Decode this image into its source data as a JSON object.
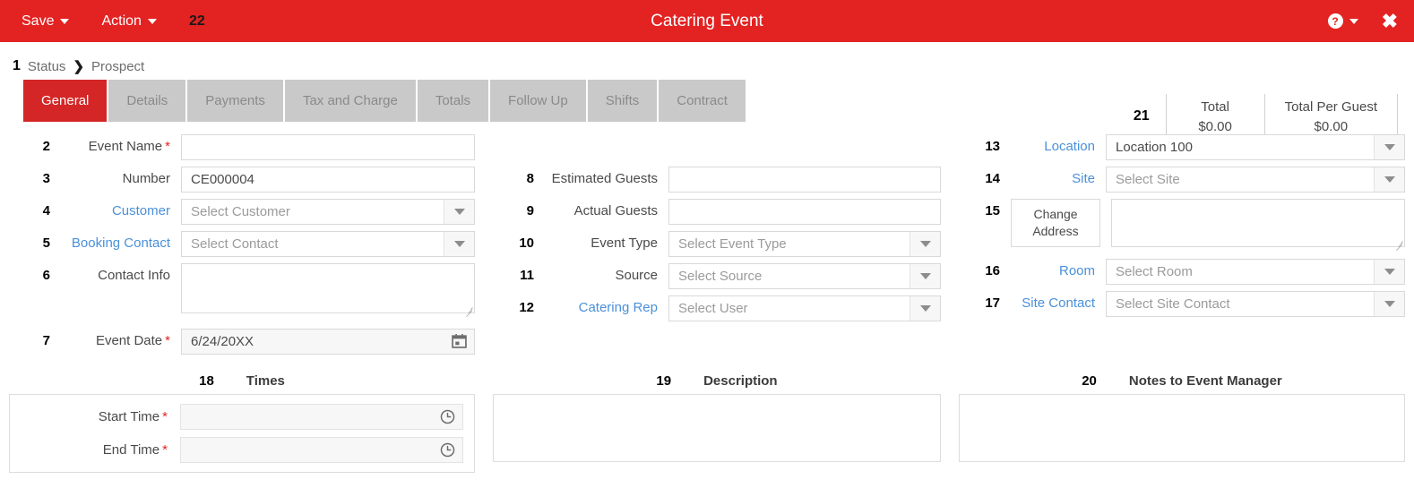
{
  "header": {
    "save_label": "Save",
    "action_label": "Action",
    "marker_22": "22",
    "title": "Catering Event",
    "help_glyph": "?",
    "close_glyph": "✖"
  },
  "status": {
    "marker_1": "1",
    "label": "Status",
    "chevron": "❯",
    "value": "Prospect"
  },
  "tabs": [
    {
      "label": "General",
      "active": true
    },
    {
      "label": "Details",
      "active": false
    },
    {
      "label": "Payments",
      "active": false
    },
    {
      "label": "Tax and Charge",
      "active": false
    },
    {
      "label": "Totals",
      "active": false
    },
    {
      "label": "Follow Up",
      "active": false
    },
    {
      "label": "Shifts",
      "active": false
    },
    {
      "label": "Contract",
      "active": false
    }
  ],
  "totals": {
    "marker_21": "21",
    "total_label": "Total",
    "total_value": "$0.00",
    "per_guest_label": "Total Per Guest",
    "per_guest_value": "$0.00"
  },
  "col_left": {
    "event_name": {
      "marker": "2",
      "label": "Event Name",
      "required": "*",
      "value": "",
      "placeholder": ""
    },
    "number": {
      "marker": "3",
      "label": "Number",
      "value": "CE000004"
    },
    "customer": {
      "marker": "4",
      "label": "Customer",
      "placeholder": "Select Customer"
    },
    "booking_contact": {
      "marker": "5",
      "label": "Booking Contact",
      "placeholder": "Select Contact"
    },
    "contact_info": {
      "marker": "6",
      "label": "Contact Info",
      "value": ""
    },
    "event_date": {
      "marker": "7",
      "label": "Event Date",
      "required": "*",
      "value": "6/24/20XX"
    }
  },
  "col_mid": {
    "estimated_guests": {
      "marker": "8",
      "label": "Estimated Guests",
      "value": ""
    },
    "actual_guests": {
      "marker": "9",
      "label": "Actual Guests",
      "value": ""
    },
    "event_type": {
      "marker": "10",
      "label": "Event Type",
      "placeholder": "Select Event Type"
    },
    "source": {
      "marker": "11",
      "label": "Source",
      "placeholder": "Select Source"
    },
    "catering_rep": {
      "marker": "12",
      "label": "Catering Rep",
      "placeholder": "Select User"
    }
  },
  "col_right": {
    "location": {
      "marker": "13",
      "label": "Location",
      "value": "Location 100"
    },
    "site": {
      "marker": "14",
      "label": "Site",
      "placeholder": "Select Site"
    },
    "change_address": {
      "marker": "15",
      "button_label": "Change Address",
      "value": ""
    },
    "room": {
      "marker": "16",
      "label": "Room",
      "placeholder": "Select Room"
    },
    "site_contact": {
      "marker": "17",
      "label": "Site Contact",
      "placeholder": "Select Site Contact"
    }
  },
  "panels": {
    "times": {
      "marker": "18",
      "title": "Times",
      "start_label": "Start Time",
      "start_required": "*",
      "start_value": "",
      "end_label": "End Time",
      "end_required": "*",
      "end_value": ""
    },
    "description": {
      "marker": "19",
      "title": "Description",
      "value": ""
    },
    "notes": {
      "marker": "20",
      "title": "Notes to Event Manager",
      "value": ""
    }
  },
  "colors": {
    "header_red": "#e32222",
    "tab_active_red": "#d42626",
    "tab_inactive_grey": "#c9c9c9",
    "link_blue": "#4a90d9",
    "required_red": "#e32222"
  }
}
